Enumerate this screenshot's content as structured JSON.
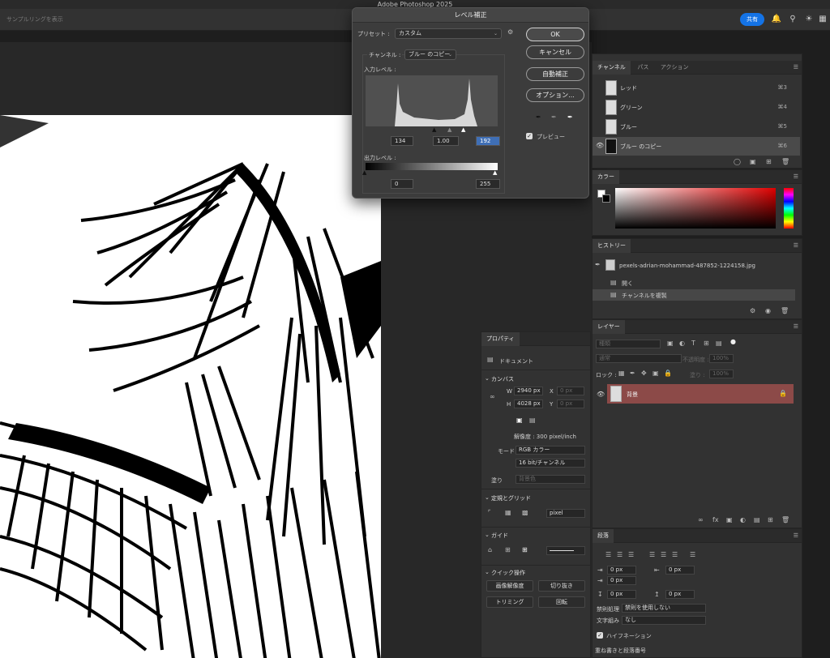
{
  "app": {
    "title": "Adobe Photoshop 2025",
    "share_label": "共有"
  },
  "optbar": {
    "hint": "サンプルリングを表示"
  },
  "levels_dialog": {
    "title": "レベル補正",
    "preset_label": "プリセット :",
    "preset_value": "カスタム",
    "channel_label": "チャンネル :",
    "channel_value": "ブルー のコピー",
    "input_label": "入力レベル :",
    "output_label": "出力レベル :",
    "input_black": "134",
    "input_gamma": "1.00",
    "input_white": "192",
    "output_black": "0",
    "output_white": "255",
    "buttons": {
      "ok": "OK",
      "cancel": "キャンセル",
      "auto": "自動補正",
      "options": "オプション..."
    },
    "preview_label": "プレビュー",
    "preview_checked": true
  },
  "channels_panel": {
    "tabs": [
      "チャンネル",
      "パス",
      "アクション"
    ],
    "rows": [
      {
        "name": "レッド",
        "key": "⌘3"
      },
      {
        "name": "グリーン",
        "key": "⌘4"
      },
      {
        "name": "ブルー",
        "key": "⌘5"
      },
      {
        "name": "ブルー のコピー",
        "key": "⌘6"
      }
    ]
  },
  "color_panel": {
    "tab": "カラー"
  },
  "history_panel": {
    "tab": "ヒストリー",
    "snapshot": "pexels-adrian-mohammad-487852-1224158.jpg",
    "items": [
      "開く",
      "チャンネルを複製"
    ]
  },
  "layers_panel": {
    "tab": "レイヤー",
    "search_placeholder": "種類",
    "blend_mode": "通常",
    "opacity_label": "不透明度 :",
    "opacity_value": "100%",
    "lock_label": "ロック :",
    "fill_label": "塗り :",
    "fill_value": "100%",
    "layer_name": "背景"
  },
  "properties_panel": {
    "tab": "プロパティ",
    "doc_label": "ドキュメント",
    "canvas_title": "カンバス",
    "w_label": "W",
    "w_value": "2940 px",
    "h_label": "H",
    "h_value": "4028 px",
    "x_label": "X",
    "x_value": "0 px",
    "y_label": "Y",
    "y_value": "0 px",
    "resolution": "解像度 : 300 pixel/inch",
    "mode_label": "モード",
    "mode_value": "RGB カラー",
    "depth_value": "16 bit/チャンネル",
    "fill_label": "塗り",
    "fill_value": "背景色",
    "ruler_title": "定規とグリッド",
    "ruler_unit": "pixel",
    "guide_title": "ガイド",
    "quick_title": "クイック操作",
    "quick_buttons": [
      "画像解像度",
      "切り抜き",
      "トリミング",
      "回転"
    ]
  },
  "paragraph_panel": {
    "tab": "段落",
    "indent_values": [
      "0 px",
      "0 px",
      "0 px",
      "0 px",
      "0 px"
    ],
    "kinsoku_label": "禁則処理",
    "kinsoku_value": "禁則を使用しない",
    "mojikumi_label": "文字組み",
    "mojikumi_value": "なし",
    "hyphenation_label": "ハイフネーション",
    "footer_label": "重ね書きと段落番号"
  },
  "colors": {
    "accent": "#1473e6",
    "layer_selected": "#8c4a48",
    "panel": "#323232"
  }
}
